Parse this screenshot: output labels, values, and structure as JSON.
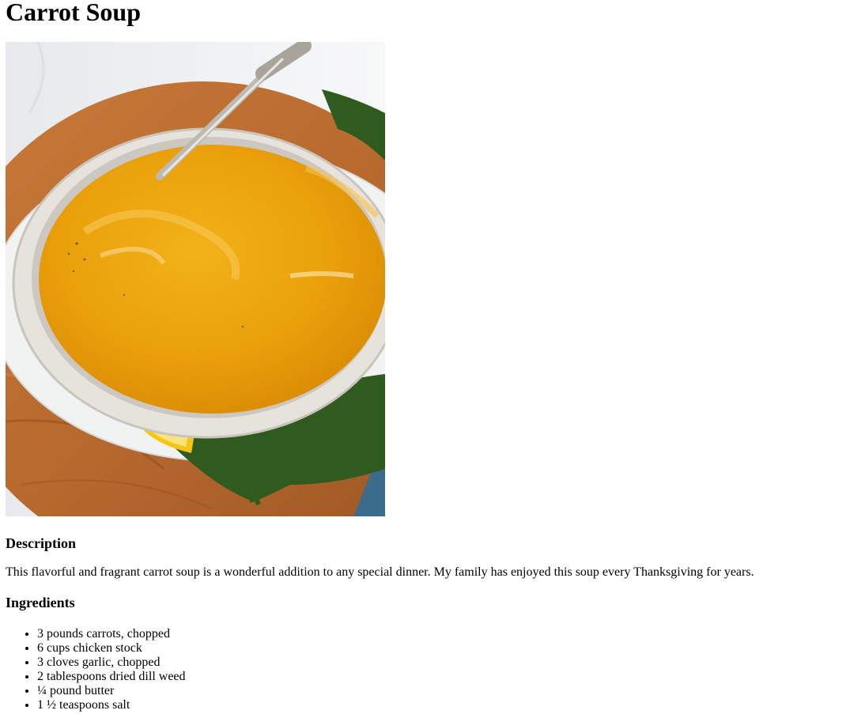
{
  "recipe": {
    "title": "Carrot Soup",
    "image_subject": "bowl of creamy orange carrot soup with spoon, lemon slice and kale on wooden board",
    "description_heading": "Description",
    "description": "This flavorful and fragrant carrot soup is a wonderful addition to any special dinner. My family has enjoyed this soup every Thanksgiving for years.",
    "ingredients_heading": "Ingredients",
    "ingredients": [
      "3 pounds carrots, chopped",
      "6 cups chicken stock",
      "3 cloves garlic, chopped",
      "2 tablespoons dried dill weed",
      "¼ pound butter",
      "1 ½ teaspoons salt"
    ]
  },
  "colors": {
    "soup": "#E9A00B",
    "bowl": "#E6E3DD",
    "wood": "#B8692E",
    "kale": "#2F5B1E",
    "lemon": "#F5C518",
    "cloth": "#3B6C8C"
  }
}
